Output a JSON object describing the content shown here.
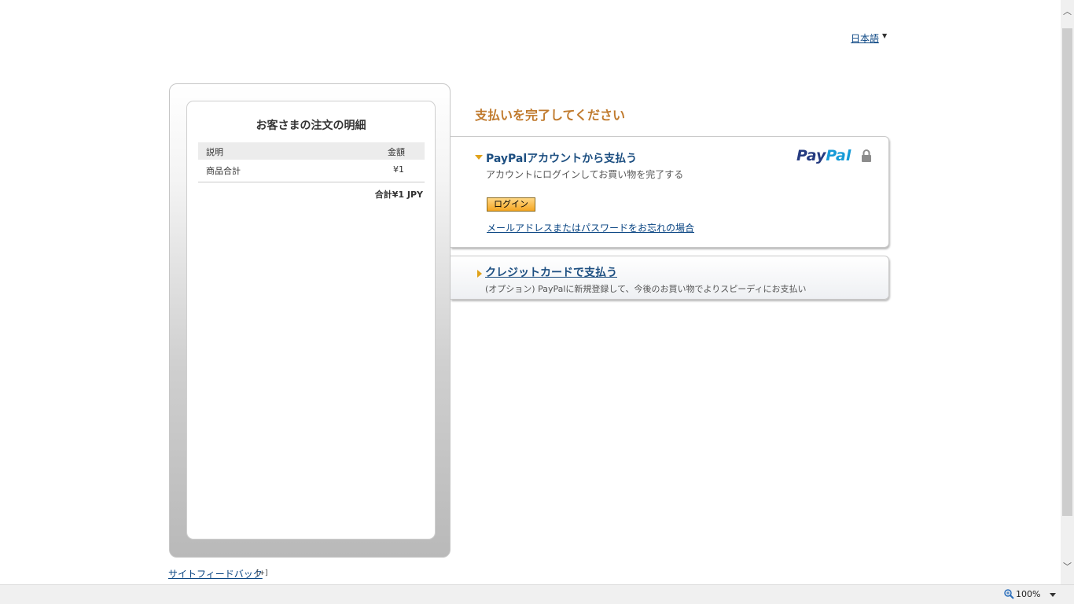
{
  "header": {
    "language": "日本語"
  },
  "summary": {
    "title": "お客さまの注文の明細",
    "col_description": "説明",
    "col_amount": "金額",
    "items": [
      {
        "name": "商品合計",
        "amount": "¥1"
      }
    ],
    "total": "合計¥1 JPY"
  },
  "main": {
    "heading": "支払いを完了してください"
  },
  "paypal_option": {
    "title": "PayPalアカウントから支払う",
    "subtitle": "アカウントにログインしてお買い物を完了する",
    "logo_pay": "Pay",
    "logo_pal": "Pal",
    "login_label": "ログイン",
    "forgot_link": "メールアドレスまたはパスワードをお忘れの場合",
    "icon": "lock-icon"
  },
  "card_option": {
    "title": "クレジットカードで支払う",
    "subtitle": "(オプション) PayPalに新規登録して、今後のお買い物でよりスピーディにお支払い"
  },
  "footer": {
    "feedback": "サイトフィードバック",
    "feedback_plus": "[+]"
  },
  "statusbar": {
    "zoom": "100%"
  },
  "colors": {
    "heading": "#c07a2d",
    "link": "#084482",
    "caret": "#e0a21a",
    "paypal_dark": "#253b80",
    "paypal_light": "#179bd7"
  }
}
